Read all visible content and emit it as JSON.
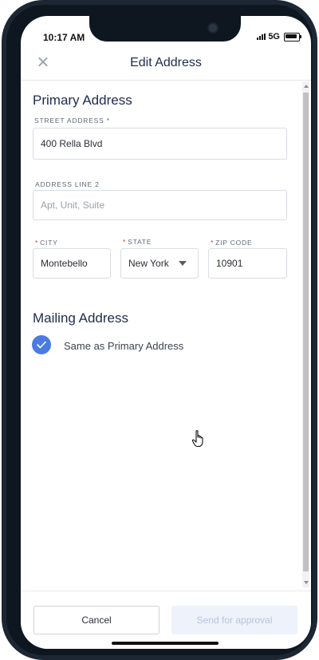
{
  "status_bar": {
    "time": "10:17 AM",
    "network": "5G"
  },
  "header": {
    "title": "Edit Address"
  },
  "primary": {
    "section_title": "Primary Address",
    "street": {
      "label": "STREET ADDRESS *",
      "value": "400 Rella Blvd"
    },
    "line2": {
      "label": "ADDRESS LINE 2",
      "placeholder": "Apt, Unit, Suite"
    },
    "city": {
      "required_mark": "*",
      "label": "CITY",
      "value": "Montebello"
    },
    "state": {
      "required_mark": "*",
      "label": "STATE",
      "value": "New York"
    },
    "zip": {
      "required_mark": "*",
      "label": "ZIP CODE",
      "value": "10901"
    }
  },
  "mailing": {
    "section_title": "Mailing Address",
    "same_as_primary": {
      "label": "Same as Primary Address",
      "checked": true
    }
  },
  "footer": {
    "cancel_label": "Cancel",
    "send_label": "Send for approval"
  },
  "colors": {
    "accent": "#4a7be3",
    "title_text": "#1f2b4d",
    "required": "#d43c3c",
    "disabled_button_bg": "#eef2fa"
  },
  "icons": {
    "close": "close-icon",
    "dropdown": "caret-down-icon",
    "checkbox": "check-icon",
    "cursor": "hand-pointer-icon"
  }
}
